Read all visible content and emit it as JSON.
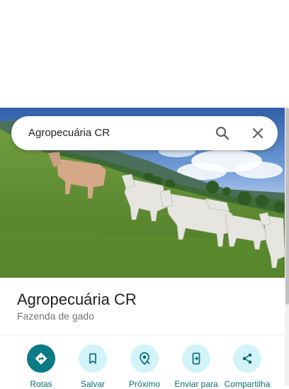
{
  "search": {
    "query": "Agropecuária CR",
    "search_icon": "search-icon",
    "close_icon": "close-icon"
  },
  "photo": {
    "subject": "herd-photo"
  },
  "place": {
    "title": "Agropecuária CR",
    "category": "Fazenda de gado"
  },
  "actions": [
    {
      "label": "Rotas",
      "icon": "directions-icon"
    },
    {
      "label": "Salvar",
      "icon": "bookmark-icon"
    },
    {
      "label": "Próximo",
      "icon": "nearby-icon"
    },
    {
      "label": "Enviar para",
      "icon": "send-to-phone-icon"
    },
    {
      "label": "Compartilha",
      "icon": "share-icon"
    }
  ],
  "colors": {
    "primary_action": "#0b7b86",
    "action_bg": "#d2f4f9",
    "action_label": "#0b6e79",
    "title": "#202124",
    "subtitle": "#70757a"
  }
}
